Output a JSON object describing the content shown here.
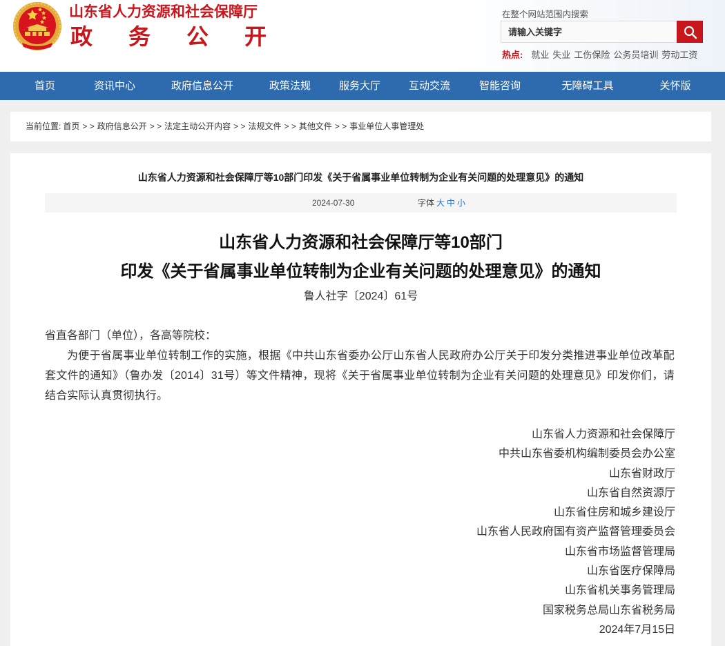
{
  "header": {
    "org_name": "山东省人力资源和社会保障厅",
    "section_name": "政务公开"
  },
  "search": {
    "label": "在整个网站范围内搜索",
    "placeholder": "请输入关键字",
    "value": "",
    "button_icon": "search-icon"
  },
  "hot": {
    "label": "热点:",
    "items": [
      "就业",
      "失业",
      "工伤保险",
      "公务员培训",
      "劳动工资"
    ]
  },
  "nav": [
    {
      "label": "首页"
    },
    {
      "label": "资讯中心"
    },
    {
      "label": "政府信息公开"
    },
    {
      "label": "政策法规"
    },
    {
      "label": "服务大厅"
    },
    {
      "label": "互动交流"
    },
    {
      "label": "智能咨询"
    },
    {
      "label": "无障碍工具"
    },
    {
      "label": "关怀版"
    }
  ],
  "breadcrumb": {
    "label": "当前位置:",
    "separator": "> >",
    "items": [
      "首页",
      "政府信息公开",
      "法定主动公开内容",
      "法规文件",
      "其他文件",
      "事业单位人事管理处"
    ]
  },
  "article": {
    "title": "山东省人力资源和社会保障厅等10部门印发《关于省属事业单位转制为企业有关问题的处理意见》的通知",
    "date": "2024-07-30",
    "font_label": "字体",
    "font_sizes": [
      "大",
      "中",
      "小"
    ],
    "doc_title_line1": "山东省人力资源和社会保障厅等10部门",
    "doc_title_line2": "印发《关于省属事业单位转制为企业有关问题的处理意见》的通知",
    "doc_number": "鲁人社字〔2024〕61号",
    "salutation": "省直各部门（单位），各高等院校：",
    "body": "为便于省属事业单位转制工作的实施，根据《中共山东省委办公厅山东省人民政府办公厅关于印发分类推进事业单位改革配套文件的通知》（鲁办发〔2014〕31号）等文件精神，现将《关于省属事业单位转制为企业有关问题的处理意见》印发你们，请结合实际认真贯彻执行。",
    "signatories": [
      "山东省人力资源和社会保障厅",
      "中共山东省委机构编制委员会办公室",
      "山东省财政厅",
      "山东省自然资源厅",
      "山东省住房和城乡建设厅",
      "山东省人民政府国有资产监督管理委员会",
      "山东省市场监督管理局",
      "山东省医疗保障局",
      "山东省机关事务管理局",
      "国家税务总局山东省税务局"
    ],
    "date_signed": "2024年7月15日"
  },
  "colors": {
    "brand_red": "#c8161d",
    "nav_blue": "#2d6bae",
    "link_blue": "#2a6fc6",
    "page_bg": "#f0f0f0"
  }
}
